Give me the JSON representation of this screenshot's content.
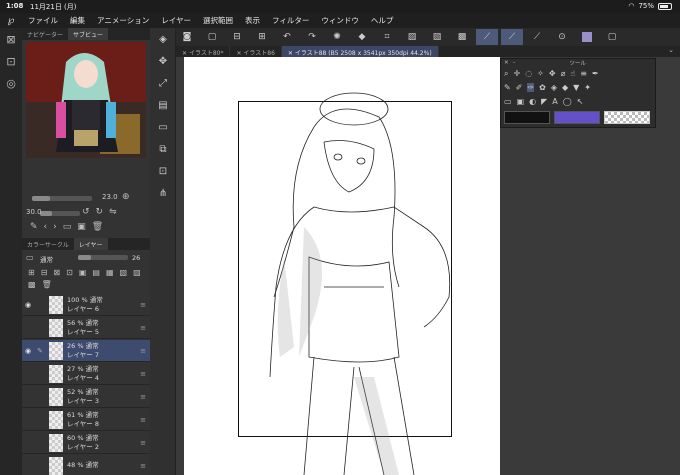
{
  "status": {
    "time": "1:08",
    "date": "11月21日 (月)",
    "battery": "75%",
    "battery_level": 0.75
  },
  "menu": [
    "ファイル",
    "編集",
    "アニメーション",
    "レイヤー",
    "選択範囲",
    "表示",
    "フィルター",
    "ウィンドウ",
    "ヘルプ"
  ],
  "navigator": {
    "tabs": [
      "ナビゲーター",
      "サブビュー"
    ],
    "zoom_value": "23.0",
    "rotate_value": "30.0"
  },
  "layers": {
    "tabs": [
      "カラーサークル",
      "レイヤー"
    ],
    "blend_mode": "通常",
    "opacity": "26",
    "items": [
      {
        "opacity": "100 % 通常",
        "name": "レイヤー 6",
        "visible": true,
        "selected": false
      },
      {
        "opacity": "56 % 通常",
        "name": "レイヤー 5",
        "visible": false,
        "selected": false
      },
      {
        "opacity": "26 % 通常",
        "name": "レイヤー 7",
        "visible": true,
        "selected": true
      },
      {
        "opacity": "27 % 通常",
        "name": "レイヤー 4",
        "visible": false,
        "selected": false
      },
      {
        "opacity": "52 % 通常",
        "name": "レイヤー 3",
        "visible": false,
        "selected": false
      },
      {
        "opacity": "61 % 通常",
        "name": "レイヤー 8",
        "visible": false,
        "selected": false
      },
      {
        "opacity": "60 % 通常",
        "name": "レイヤー 2",
        "visible": false,
        "selected": false
      },
      {
        "opacity": "48 % 通常",
        "name": "",
        "visible": false,
        "selected": false
      }
    ]
  },
  "documents": {
    "tabs": [
      "イラスト80*",
      "イラスト86",
      "イラスト88 (B5 2508 x 3541px 350dpi 44.2%)"
    ],
    "active_index": 2
  },
  "tool_panel": {
    "title": "ツール"
  },
  "colors": {
    "main": "#111111",
    "sub": "#6451c9",
    "swatch": "#9a8fc6",
    "accent": "#4d5a7a"
  }
}
